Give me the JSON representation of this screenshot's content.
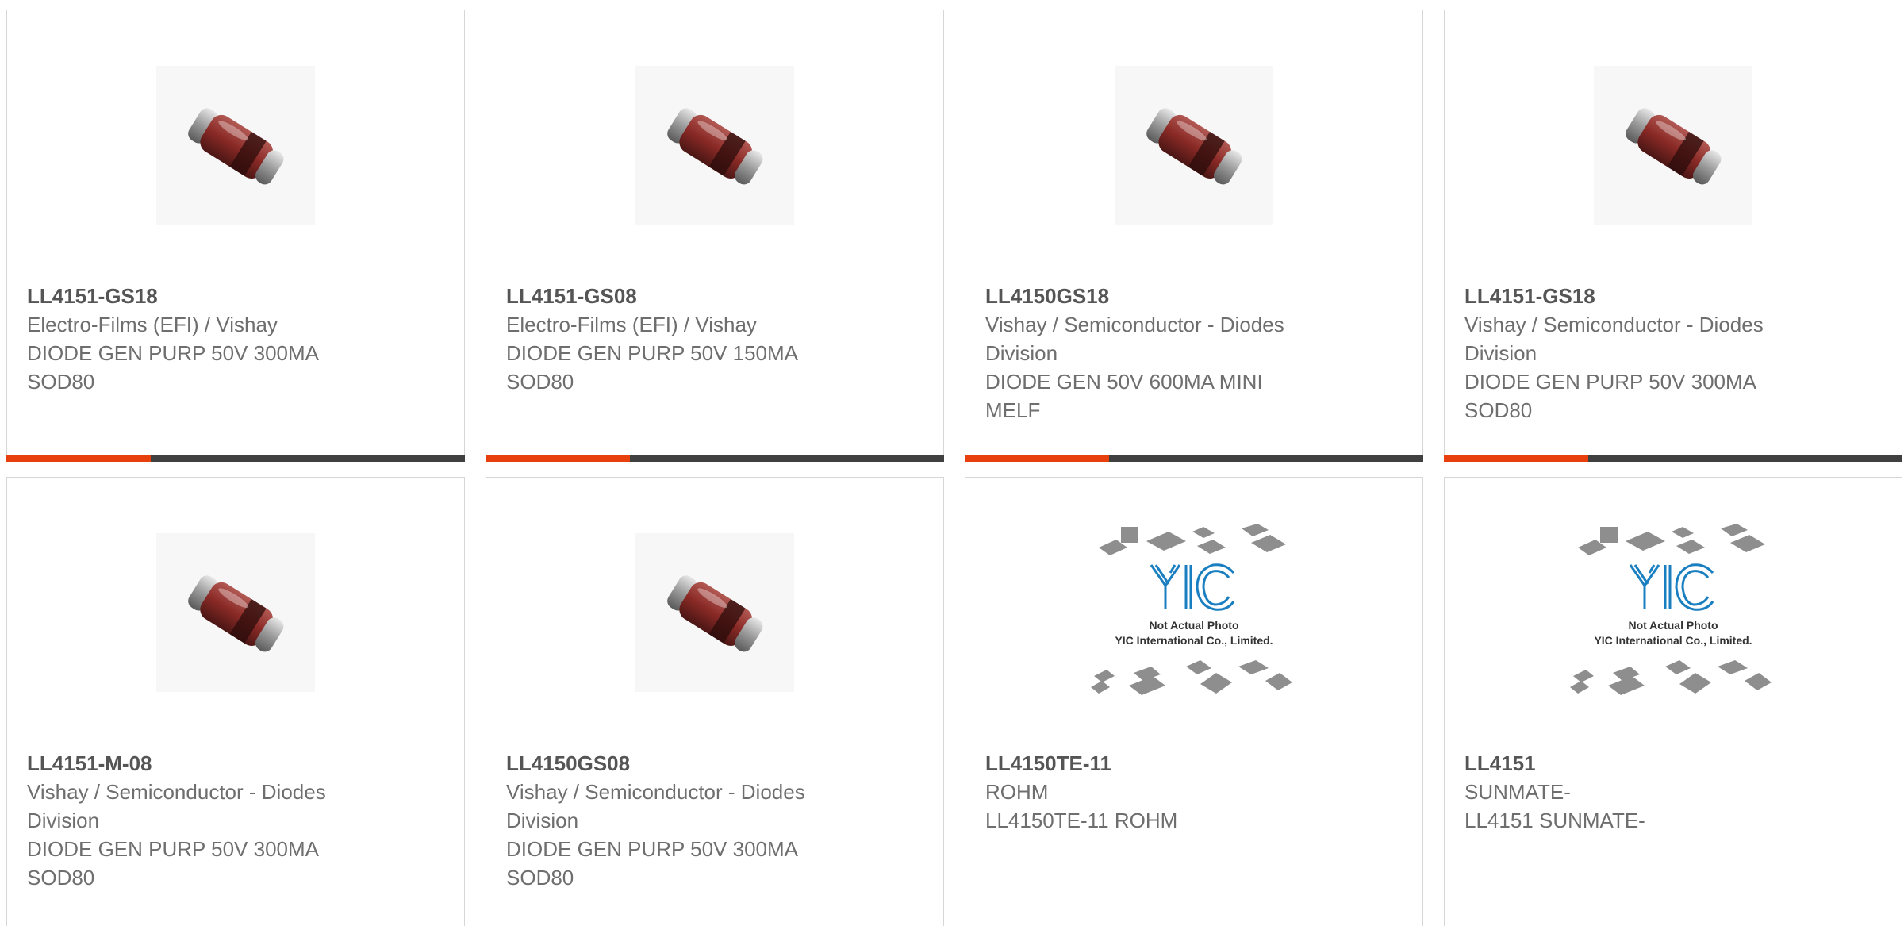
{
  "colors": {
    "accent": "#e8400c",
    "bar": "#404040",
    "part_number": "#555555",
    "text": "#6e6e6e"
  },
  "products": [
    {
      "part_number": "LL4151-GS18",
      "lines": [
        "Electro-Films (EFI) / Vishay",
        "DIODE GEN PURP 50V 300MA",
        "SOD80"
      ],
      "image": "diode-melf-icon"
    },
    {
      "part_number": "LL4151-GS08",
      "lines": [
        "Electro-Films (EFI) / Vishay",
        "DIODE GEN PURP 50V 150MA",
        "SOD80"
      ],
      "image": "diode-melf-icon"
    },
    {
      "part_number": "LL4150GS18",
      "lines": [
        "Vishay / Semiconductor - Diodes",
        "Division",
        "DIODE GEN 50V 600MA MINI",
        "MELF"
      ],
      "image": "diode-melf-icon"
    },
    {
      "part_number": "LL4151-GS18",
      "lines": [
        "Vishay / Semiconductor - Diodes",
        "Division",
        "DIODE GEN PURP 50V 300MA",
        "SOD80"
      ],
      "image": "diode-melf-icon"
    },
    {
      "part_number": "LL4151-M-08",
      "lines": [
        "Vishay / Semiconductor - Diodes",
        "Division",
        "DIODE GEN PURP 50V 300MA",
        "SOD80"
      ],
      "image": "diode-melf-icon"
    },
    {
      "part_number": "LL4150GS08",
      "lines": [
        "Vishay / Semiconductor - Diodes",
        "Division",
        "DIODE GEN PURP 50V 300MA",
        "SOD80"
      ],
      "image": "diode-melf-icon"
    },
    {
      "part_number": "LL4150TE-11",
      "lines": [
        "ROHM",
        "LL4150TE-11 ROHM"
      ],
      "image": "not-actual-photo-placeholder",
      "placeholder": {
        "logo_text": "YIC",
        "caption_line1": "Not Actual Photo",
        "caption_line2": "YIC International Co., Limited."
      }
    },
    {
      "part_number": "LL4151",
      "lines": [
        "SUNMATE-",
        "LL4151 SUNMATE-"
      ],
      "image": "not-actual-photo-placeholder",
      "placeholder": {
        "logo_text": "YIC",
        "caption_line1": "Not Actual Photo",
        "caption_line2": "YIC International Co., Limited."
      }
    }
  ]
}
